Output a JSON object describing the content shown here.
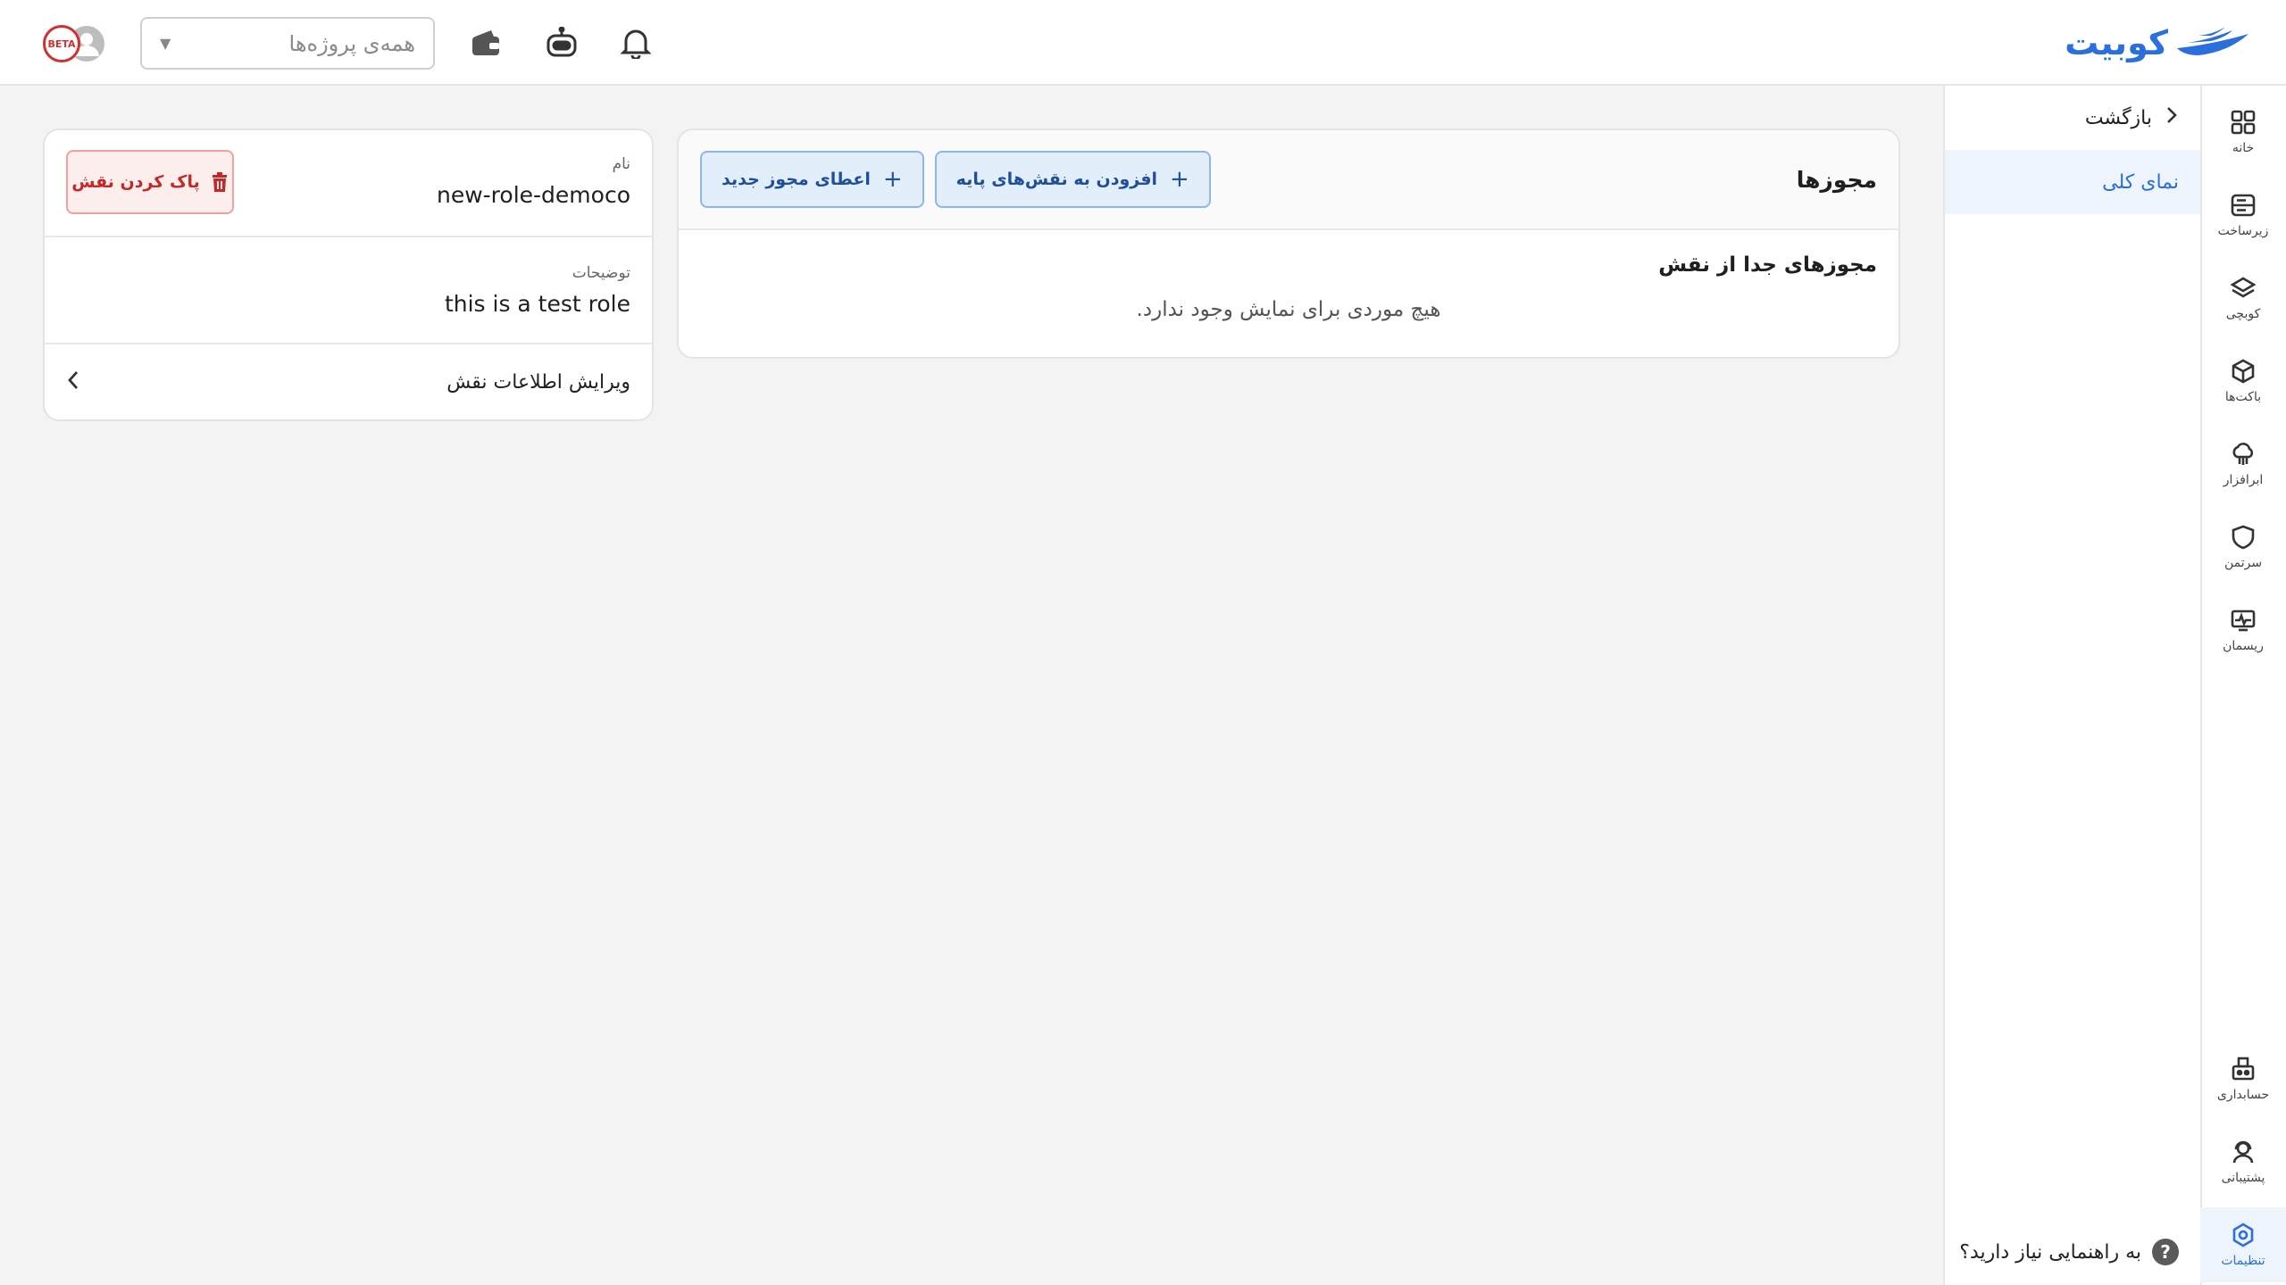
{
  "brand": {
    "name": "کوبیت",
    "color": "#2a6fdb"
  },
  "topbar": {
    "project_select": {
      "placeholder": "همه‌ی پروژه‌ها"
    },
    "icons": [
      "bell-icon",
      "robot-icon",
      "wallet-icon"
    ],
    "avatar_badge": "BETA"
  },
  "rail": {
    "items": [
      {
        "label": "خانه",
        "icon": "grid-icon"
      },
      {
        "label": "زیرساخت",
        "icon": "server-icon"
      },
      {
        "label": "کوبچی",
        "icon": "layers-icon"
      },
      {
        "label": "باکت‌ها",
        "icon": "cube-icon"
      },
      {
        "label": "ابرافزار",
        "icon": "cloud-icon"
      },
      {
        "label": "سرتمن",
        "icon": "shield-icon"
      },
      {
        "label": "ریسمان",
        "icon": "monitor-icon"
      }
    ],
    "bottom": [
      {
        "label": "حسابداری",
        "icon": "billing-icon"
      },
      {
        "label": "پشتیبانی",
        "icon": "support-icon"
      },
      {
        "label": "تنظیمات",
        "icon": "settings-icon",
        "active": true
      }
    ]
  },
  "subnav": {
    "back_label": "بازگشت",
    "active_item": "نمای کلی",
    "help_label": "به راهنمایی نیاز دارید؟",
    "help_mark": "?"
  },
  "permissions": {
    "title": "مجوزها",
    "add_to_base_roles": "افزودن به نقش‌های پایه",
    "grant_new_permission": "اعطای مجوز جدید",
    "plus": "+",
    "separate_title": "مجوزهای جدا از نقش",
    "empty_text": "هیچ موردی برای نمایش وجود ندارد."
  },
  "role": {
    "name_label": "نام",
    "name_value": "new-role-democo",
    "delete_button": "پاک کردن نقش",
    "description_label": "توضیحات",
    "description_value": "this is a test role",
    "edit_label": "ویرایش اطلاعات نقش"
  }
}
